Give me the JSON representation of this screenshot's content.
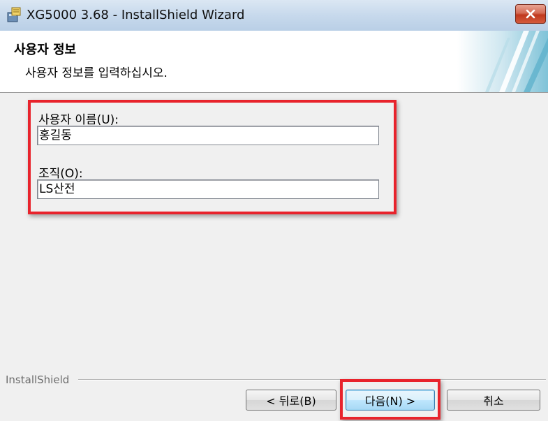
{
  "window": {
    "title": "XG5000 3.68 - InstallShield Wizard",
    "icon": "installer-icon",
    "close_icon": "close-icon"
  },
  "banner": {
    "title": "사용자 정보",
    "subtitle": "사용자 정보를 입력하십시오."
  },
  "form": {
    "user_label": "사용자 이름(U):",
    "user_value": "홍길동",
    "org_label": "조직(O):",
    "org_value": "LS산전"
  },
  "footer": {
    "brand": "InstallShield",
    "back_label": "< 뒤로(B)",
    "next_label": "다음(N) >",
    "cancel_label": "취소"
  },
  "colors": {
    "highlight": "#e8232c",
    "title_bar": "#c7d9ec",
    "accent": "#3c7fb1"
  }
}
